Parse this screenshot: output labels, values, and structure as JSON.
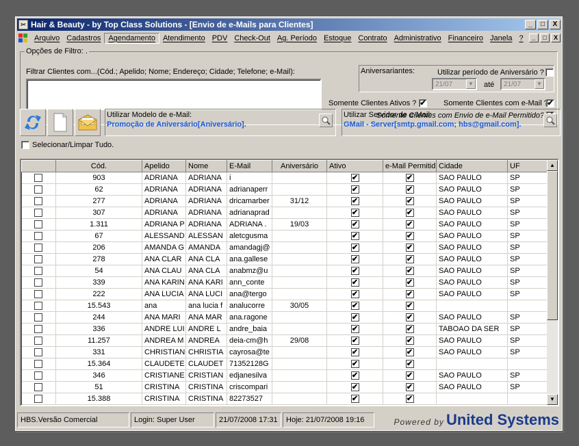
{
  "window": {
    "title": "Hair & Beauty - by Top Class Solutions - [Envio de e-Mails para Clientes]",
    "buttons": [
      "_",
      "□",
      "X"
    ]
  },
  "menu": {
    "items": [
      "Arquivo",
      "Cadastros",
      "Agendamento",
      "Atendimento",
      "PDV",
      "Check-Out",
      "Ag. Período",
      "Estoque",
      "Contrato",
      "Administrativo",
      "Financeiro",
      "Janela",
      "?"
    ]
  },
  "filter": {
    "legend": "Opções de Filtro: .",
    "search_label": "Filtrar Clientes com...(Cód.;  Apelido;  Nome;  Endereço;  Cidade;  Telefone;  e-Mail):",
    "search_value": "",
    "birthday_label": "Aniversariantes:",
    "birthday_period_label": "Utilizar período de Aniversário ?",
    "date_from": "21/07",
    "date_to_label": "até",
    "date_to": "21/07",
    "only_active_label": "Somente Clientes Ativos ?",
    "only_email_label": "Somente Clientes com e-Mail ?",
    "only_permitted_label": "Somente Clientes com Envio de e-Mail Permitido?",
    "checkmark": "✔"
  },
  "email_model": {
    "caption": "Utilizar Modelo de e-Mail:",
    "value": "Promoção de Aniversário[Aniversário]."
  },
  "email_server": {
    "caption": "Utilizar Servidor de e-Mail:",
    "value": "GMail - Server[smtp.gmail.com; hbs@gmail.com]."
  },
  "select_all_label": "Selecionar/Limpar Tudo.",
  "grid": {
    "columns": [
      "",
      "Cód.",
      "Apelido",
      "Nome",
      "E-Mail",
      "Aniversário",
      "Ativo",
      "e-Mail Permitid",
      "Cidade",
      "UF"
    ],
    "rows": [
      [
        "903",
        "ADRIANA",
        "ADRIANA",
        "i",
        "",
        "SAO PAULO",
        "SP"
      ],
      [
        "62",
        "ADRIANA",
        "ADRIANA",
        "adrianaperr",
        "",
        "SAO PAULO",
        "SP"
      ],
      [
        "277",
        "ADRIANA",
        "ADRIANA",
        "dricamarber",
        "31/12",
        "SAO PAULO",
        "SP"
      ],
      [
        "307",
        "ADRIANA",
        "ADRIANA",
        "adrianaprad",
        "",
        "SAO PAULO",
        "SP"
      ],
      [
        "1.311",
        "ADRIANA P",
        "ADRIANA",
        "ADRIANA .",
        "19/03",
        "SAO PAULO",
        "SP"
      ],
      [
        "67",
        "ALESSAND",
        "ALESSAN",
        "aletcgusma",
        "",
        "SAO PAULO",
        "SP"
      ],
      [
        "206",
        "AMANDA G",
        "AMANDA",
        "amandagj@",
        "",
        "SAO PAULO",
        "SP"
      ],
      [
        "278",
        "ANA CLAR",
        "ANA CLA",
        "ana.gallese",
        "",
        "SAO PAULO",
        "SP"
      ],
      [
        "54",
        "ANA CLAU",
        "ANA CLA",
        "anabmz@u",
        "",
        "SAO PAULO",
        "SP"
      ],
      [
        "339",
        "ANA KARIN",
        "ANA KARI",
        "ann_conte",
        "",
        "SAO PAULO",
        "SP"
      ],
      [
        "222",
        "ANA LUCIA",
        "ANA LUCI",
        "ana@tergo",
        "",
        "SAO PAULO",
        "SP"
      ],
      [
        "15.543",
        "ana",
        "ana lucia f",
        "analucorre",
        "30/05",
        "",
        ""
      ],
      [
        "244",
        "ANA MARI",
        "ANA MAR",
        "ana.ragone",
        "",
        "SAO PAULO",
        "SP"
      ],
      [
        "336",
        "ANDRE LUI",
        "ANDRE L",
        "andre_baia",
        "",
        "TABOAO DA SER",
        "SP"
      ],
      [
        "11.257",
        "ANDREA M",
        "ANDREA",
        "deia-cm@h",
        "29/08",
        "SAO PAULO",
        "SP"
      ],
      [
        "331",
        "CHRISTIAN",
        "CHRISTIA",
        "cayrosa@te",
        "",
        "SAO PAULO",
        "SP"
      ],
      [
        "15.364",
        "CLAUDETE",
        "CLAUDET",
        "71352128G",
        "",
        "",
        ""
      ],
      [
        "346",
        "CRISTIANE",
        "CRISTIAN",
        "edjanesilva",
        "",
        "SAO PAULO",
        "SP"
      ],
      [
        "51",
        "CRISTINA",
        "CRISTINA",
        "criscompari",
        "",
        "SAO PAULO",
        "SP"
      ],
      [
        "15.388",
        "CRISTINA",
        "CRISTINA",
        "82273527",
        "",
        "",
        ""
      ]
    ]
  },
  "status": {
    "version": "HBS.Versão Comercial",
    "login_label": "Login:",
    "login_user": "Super User",
    "login_time": "21/07/2008 17:31",
    "today_label": "Hoje:",
    "today_time": "21/07/2008 19:16",
    "powered_by": "Powered by",
    "brand": "United Systems"
  }
}
